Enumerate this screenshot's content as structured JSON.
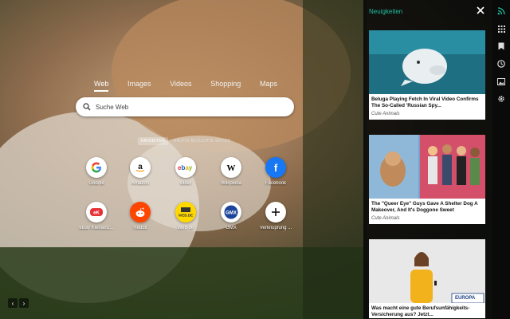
{
  "search": {
    "tabs": [
      {
        "label": "Web",
        "active": true
      },
      {
        "label": "Images",
        "active": false
      },
      {
        "label": "Videos",
        "active": false
      },
      {
        "label": "Shopping",
        "active": false
      },
      {
        "label": "Maps",
        "active": false
      }
    ],
    "placeholder": "Suche Web"
  },
  "quicklinks": {
    "tabs": [
      {
        "label": "FAVORITEN",
        "active": true
      },
      {
        "label": "HÄUFIG BESUCHTE SEITEN",
        "active": false
      }
    ],
    "tiles": [
      {
        "label": "Google",
        "icon": "google-icon",
        "color": "#4285F4"
      },
      {
        "label": "Amazon",
        "icon": "amazon-icon",
        "color": "#000000"
      },
      {
        "label": "eBay",
        "icon": "ebay-icon",
        "color": "#e53238"
      },
      {
        "label": "Wikipedia",
        "icon": "wikipedia-icon",
        "color": "#000000"
      },
      {
        "label": "Facebook",
        "icon": "facebook-icon",
        "color": "#1877F2"
      },
      {
        "label": "eBay Kleinanz...",
        "icon": "ebay-kleinanzeigen-icon",
        "color": "#e53238"
      },
      {
        "label": "Reddit",
        "icon": "reddit-icon",
        "color": "#FF4500"
      },
      {
        "label": "Web.de",
        "icon": "webde-icon",
        "color": "#FFD800"
      },
      {
        "label": "GMX",
        "icon": "gmx-icon",
        "color": "#1c449b"
      },
      {
        "label": "Verknüpfung ...",
        "icon": "plus-icon",
        "color": "#000000"
      }
    ]
  },
  "news": {
    "title": "Neuigkeiten",
    "accent": "#1fbfa0",
    "articles": [
      {
        "title": "Beluga Playing Fetch In Viral Video Confirms The So-Called 'Russian Spy...",
        "source": "Cute Animals"
      },
      {
        "title": "The \"Queer Eye\" Guys Gave A Shelter Dog A Makeover, And It's Doggone Sweet",
        "source": "Cute Animals"
      },
      {
        "title": "Was macht eine gute Berufsunfähigkeits-Versicherung aus? Jetzt...",
        "source": "",
        "image_text": "EUROPA"
      }
    ]
  },
  "sidebar_icons": [
    "rss-icon",
    "apps-grid-icon",
    "bookmark-icon",
    "history-icon",
    "image-icon",
    "gear-icon"
  ],
  "nav": {
    "prev": "‹",
    "next": "›"
  }
}
